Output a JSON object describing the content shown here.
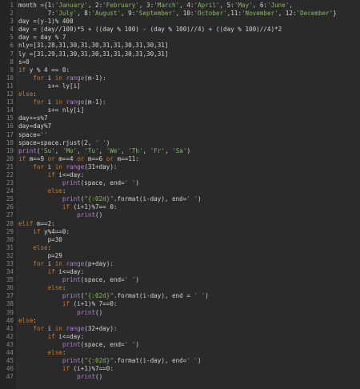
{
  "colors": {
    "background": "#2a2a2a",
    "gutter": "#252525",
    "line_number": "#858585",
    "text": "#d4d4d4",
    "keyword": "#cc7832",
    "builtin": "#b07fd1",
    "string": "#8ab466"
  },
  "lines": [
    {
      "n": "1",
      "tokens": [
        [
          "plain",
          "month ={1:"
        ],
        [
          "str",
          "'January'"
        ],
        [
          "plain",
          ", 2:"
        ],
        [
          "str",
          "'February'"
        ],
        [
          "plain",
          ", 3:"
        ],
        [
          "str",
          "'March'"
        ],
        [
          "plain",
          ", 4:"
        ],
        [
          "str",
          "'April'"
        ],
        [
          "plain",
          ", 5:"
        ],
        [
          "str",
          "'May'"
        ],
        [
          "plain",
          ", 6:"
        ],
        [
          "str",
          "'June'"
        ],
        [
          "plain",
          ","
        ]
      ]
    },
    {
      "n": "2",
      "tokens": [
        [
          "plain",
          "        7:"
        ],
        [
          "str",
          "'July'"
        ],
        [
          "plain",
          ", 8:"
        ],
        [
          "str",
          "'August'"
        ],
        [
          "plain",
          ", 9:"
        ],
        [
          "str",
          "'September'"
        ],
        [
          "plain",
          ", 10:"
        ],
        [
          "str",
          "'October'"
        ],
        [
          "plain",
          ",11:"
        ],
        [
          "str",
          "'November'"
        ],
        [
          "plain",
          ", 12:"
        ],
        [
          "str",
          "'December'"
        ],
        [
          "plain",
          "}"
        ]
      ]
    },
    {
      "n": "3",
      "tokens": [
        [
          "plain",
          "day =(y-1)% 400"
        ]
      ]
    },
    {
      "n": "4",
      "tokens": [
        [
          "plain",
          "day = (day//100)*5 + ((day % 100) - (day % 100)//4) + ((day % 100)//4)*2"
        ]
      ]
    },
    {
      "n": "5",
      "tokens": [
        [
          "plain",
          "day = day % 7"
        ]
      ]
    },
    {
      "n": "6",
      "tokens": [
        [
          "plain",
          "nly=[31,28,31,30,31,30,31,31,30,31,30,31]"
        ]
      ]
    },
    {
      "n": "7",
      "tokens": [
        [
          "plain",
          "ly =[31,29,31,30,31,30,31,31,30,31,30,31]"
        ]
      ]
    },
    {
      "n": "8",
      "tokens": [
        [
          "plain",
          "s=0"
        ]
      ]
    },
    {
      "n": "9",
      "tokens": [
        [
          "kw",
          "if"
        ],
        [
          "plain",
          " y % 4 == 0:"
        ]
      ]
    },
    {
      "n": "10",
      "tokens": [
        [
          "plain",
          "    "
        ],
        [
          "kw",
          "for"
        ],
        [
          "plain",
          " i "
        ],
        [
          "kw",
          "in"
        ],
        [
          "plain",
          " "
        ],
        [
          "bi",
          "range"
        ],
        [
          "plain",
          "(m-1):"
        ]
      ]
    },
    {
      "n": "11",
      "tokens": [
        [
          "plain",
          "        s+= ly[i]"
        ]
      ]
    },
    {
      "n": "12",
      "tokens": [
        [
          "kw",
          "else"
        ],
        [
          "plain",
          ":"
        ]
      ]
    },
    {
      "n": "13",
      "tokens": [
        [
          "plain",
          "    "
        ],
        [
          "kw",
          "for"
        ],
        [
          "plain",
          " i "
        ],
        [
          "kw",
          "in"
        ],
        [
          "plain",
          " "
        ],
        [
          "bi",
          "range"
        ],
        [
          "plain",
          "(m-1):"
        ]
      ]
    },
    {
      "n": "14",
      "tokens": [
        [
          "plain",
          "        s+= nly[i]"
        ]
      ]
    },
    {
      "n": "15",
      "tokens": [
        [
          "plain",
          "day+=s%7"
        ]
      ]
    },
    {
      "n": "16",
      "tokens": [
        [
          "plain",
          "day=day%7"
        ]
      ]
    },
    {
      "n": "17",
      "tokens": [
        [
          "plain",
          "space="
        ],
        [
          "str",
          "''"
        ]
      ]
    },
    {
      "n": "18",
      "tokens": [
        [
          "plain",
          "space=space.rjust(2, "
        ],
        [
          "str",
          "' '"
        ],
        [
          "plain",
          ")"
        ]
      ]
    },
    {
      "n": "19",
      "tokens": [
        [
          "bi",
          "print"
        ],
        [
          "plain",
          "("
        ],
        [
          "str",
          "'Su'"
        ],
        [
          "plain",
          ", "
        ],
        [
          "str",
          "'Mo'"
        ],
        [
          "plain",
          ", "
        ],
        [
          "str",
          "'Tu'"
        ],
        [
          "plain",
          ", "
        ],
        [
          "str",
          "'We'"
        ],
        [
          "plain",
          ", "
        ],
        [
          "str",
          "'Th'"
        ],
        [
          "plain",
          ", "
        ],
        [
          "str",
          "'Fr'"
        ],
        [
          "plain",
          ", "
        ],
        [
          "str",
          "'Sa'"
        ],
        [
          "plain",
          ")"
        ]
      ]
    },
    {
      "n": "20",
      "tokens": [
        [
          "kw",
          "if"
        ],
        [
          "plain",
          " m==9 "
        ],
        [
          "kw",
          "or"
        ],
        [
          "plain",
          " m==4 "
        ],
        [
          "kw",
          "or"
        ],
        [
          "plain",
          " m==6 "
        ],
        [
          "kw",
          "or"
        ],
        [
          "plain",
          " m==11:"
        ]
      ]
    },
    {
      "n": "21",
      "tokens": [
        [
          "plain",
          "    "
        ],
        [
          "kw",
          "for"
        ],
        [
          "plain",
          " i "
        ],
        [
          "kw",
          "in"
        ],
        [
          "plain",
          " "
        ],
        [
          "bi",
          "range"
        ],
        [
          "plain",
          "(31+day):"
        ]
      ]
    },
    {
      "n": "22",
      "tokens": [
        [
          "plain",
          "        "
        ],
        [
          "kw",
          "if"
        ],
        [
          "plain",
          " i<=day:"
        ]
      ]
    },
    {
      "n": "23",
      "tokens": [
        [
          "plain",
          "            "
        ],
        [
          "bi",
          "print"
        ],
        [
          "plain",
          "(space, end="
        ],
        [
          "str",
          "' '"
        ],
        [
          "plain",
          ")"
        ]
      ]
    },
    {
      "n": "24",
      "tokens": [
        [
          "plain",
          "        "
        ],
        [
          "kw",
          "else"
        ],
        [
          "plain",
          ":"
        ]
      ]
    },
    {
      "n": "25",
      "tokens": [
        [
          "plain",
          "            "
        ],
        [
          "bi",
          "print"
        ],
        [
          "plain",
          "("
        ],
        [
          "str",
          "\"{:02d}\""
        ],
        [
          "plain",
          ".format(i-day), end="
        ],
        [
          "str",
          "' '"
        ],
        [
          "plain",
          ")"
        ]
      ]
    },
    {
      "n": "26",
      "tokens": [
        [
          "plain",
          "            "
        ],
        [
          "kw",
          "if"
        ],
        [
          "plain",
          " (i+1)%7== 0:"
        ]
      ]
    },
    {
      "n": "27",
      "tokens": [
        [
          "plain",
          "                "
        ],
        [
          "bi",
          "print"
        ],
        [
          "plain",
          "()"
        ]
      ]
    },
    {
      "n": "28",
      "tokens": [
        [
          "kw",
          "elif"
        ],
        [
          "plain",
          " m==2:"
        ]
      ]
    },
    {
      "n": "29",
      "tokens": [
        [
          "plain",
          "    "
        ],
        [
          "kw",
          "if"
        ],
        [
          "plain",
          " y%4==0:"
        ]
      ]
    },
    {
      "n": "30",
      "tokens": [
        [
          "plain",
          "        p=30"
        ]
      ]
    },
    {
      "n": "31",
      "tokens": [
        [
          "plain",
          "    "
        ],
        [
          "kw",
          "else"
        ],
        [
          "plain",
          ":"
        ]
      ]
    },
    {
      "n": "32",
      "tokens": [
        [
          "plain",
          "        p=29"
        ]
      ]
    },
    {
      "n": "33",
      "tokens": [
        [
          "plain",
          "    "
        ],
        [
          "kw",
          "for"
        ],
        [
          "plain",
          " i "
        ],
        [
          "kw",
          "in"
        ],
        [
          "plain",
          " "
        ],
        [
          "bi",
          "range"
        ],
        [
          "plain",
          "(p+day):"
        ]
      ]
    },
    {
      "n": "34",
      "tokens": [
        [
          "plain",
          "        "
        ],
        [
          "kw",
          "if"
        ],
        [
          "plain",
          " i<=day:"
        ]
      ]
    },
    {
      "n": "35",
      "tokens": [
        [
          "plain",
          "            "
        ],
        [
          "bi",
          "print"
        ],
        [
          "plain",
          "(space, end="
        ],
        [
          "str",
          "' '"
        ],
        [
          "plain",
          ")"
        ]
      ]
    },
    {
      "n": "36",
      "tokens": [
        [
          "plain",
          "        "
        ],
        [
          "kw",
          "else"
        ],
        [
          "plain",
          ":"
        ]
      ]
    },
    {
      "n": "37",
      "tokens": [
        [
          "plain",
          "            "
        ],
        [
          "bi",
          "print"
        ],
        [
          "plain",
          "("
        ],
        [
          "str",
          "\"{:02d}\""
        ],
        [
          "plain",
          ".format(i-day), end = "
        ],
        [
          "str",
          "' '"
        ],
        [
          "plain",
          ")"
        ]
      ]
    },
    {
      "n": "38",
      "tokens": [
        [
          "plain",
          "            "
        ],
        [
          "kw",
          "if"
        ],
        [
          "plain",
          " (i+1)% 7==0:"
        ]
      ]
    },
    {
      "n": "39",
      "tokens": [
        [
          "plain",
          "                "
        ],
        [
          "bi",
          "print"
        ],
        [
          "plain",
          "()"
        ]
      ]
    },
    {
      "n": "40",
      "tokens": [
        [
          "kw",
          "else"
        ],
        [
          "plain",
          ":"
        ]
      ]
    },
    {
      "n": "41",
      "tokens": [
        [
          "plain",
          "    "
        ],
        [
          "kw",
          "for"
        ],
        [
          "plain",
          " i "
        ],
        [
          "kw",
          "in"
        ],
        [
          "plain",
          " "
        ],
        [
          "bi",
          "range"
        ],
        [
          "plain",
          "(32+day):"
        ]
      ]
    },
    {
      "n": "42",
      "tokens": [
        [
          "plain",
          "        "
        ],
        [
          "kw",
          "if"
        ],
        [
          "plain",
          " i<=day:"
        ]
      ]
    },
    {
      "n": "43",
      "tokens": [
        [
          "plain",
          "            "
        ],
        [
          "bi",
          "print"
        ],
        [
          "plain",
          "(space, end="
        ],
        [
          "str",
          "' '"
        ],
        [
          "plain",
          ")"
        ]
      ]
    },
    {
      "n": "44",
      "tokens": [
        [
          "plain",
          "        "
        ],
        [
          "kw",
          "else"
        ],
        [
          "plain",
          ":"
        ]
      ]
    },
    {
      "n": "45",
      "tokens": [
        [
          "plain",
          "            "
        ],
        [
          "bi",
          "print"
        ],
        [
          "plain",
          "("
        ],
        [
          "str",
          "\"{:02d}\""
        ],
        [
          "plain",
          ".format(i-day), end="
        ],
        [
          "str",
          "' '"
        ],
        [
          "plain",
          ")"
        ]
      ]
    },
    {
      "n": "46",
      "tokens": [
        [
          "plain",
          "            "
        ],
        [
          "kw",
          "if"
        ],
        [
          "plain",
          " (i+1)%7==0:"
        ]
      ]
    },
    {
      "n": "47",
      "tokens": [
        [
          "plain",
          "                "
        ],
        [
          "bi",
          "print"
        ],
        [
          "plain",
          "()"
        ]
      ]
    }
  ]
}
